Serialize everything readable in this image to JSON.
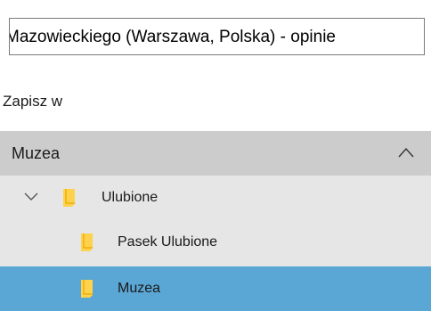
{
  "name_field": {
    "value": "Mazowieckiego (Warszawa, Polska) - opinie"
  },
  "save_in": {
    "label": "Zapisz w"
  },
  "folder_dropdown": {
    "selected": "Muzea"
  },
  "folder_tree": {
    "items": [
      {
        "label": "Ulubione",
        "expanded": true,
        "icon": "folder-icon"
      },
      {
        "label": "Pasek Ulubione",
        "icon": "folder-icon"
      },
      {
        "label": "Muzea",
        "selected": true,
        "icon": "folder-icon"
      }
    ]
  },
  "colors": {
    "header_bg": "#cccccc",
    "tree_bg": "#e6e6e6",
    "selected_bg": "#5aa6d4",
    "folder_yellow": "#ffd24d"
  }
}
